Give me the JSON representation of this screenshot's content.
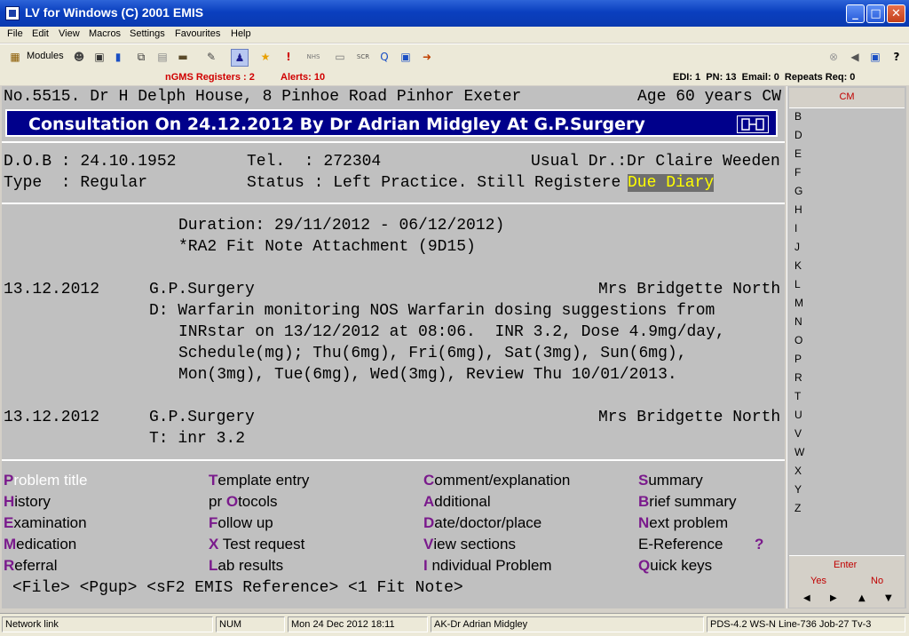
{
  "window": {
    "title": "LV for Windows (C) 2001 EMIS"
  },
  "menu": [
    "File",
    "Edit",
    "View",
    "Macros",
    "Settings",
    "Favourites",
    "Help"
  ],
  "toolbar": {
    "modules_label": "Modules"
  },
  "status_strip": {
    "ngms": "nGMS Registers : 2",
    "alerts": "Alerts: 10",
    "right": "EDI: 1  PN: 13  Email: 0  Repeats Req: 0"
  },
  "patient": {
    "address_line": "No.5515. Dr H Delph House, 8 Pinhoe Road Pinhor Exeter",
    "age": "Age 60 years CW",
    "dob": "D.O.B : 24.10.1952",
    "tel": "Tel.  : 272304",
    "usual_dr": "Usual Dr.:Dr Claire Weeden",
    "type": "Type  : Regular",
    "status": "Status : Left Practice. Still Registere",
    "due_diary": "Due Diary"
  },
  "consultation_banner": "Consultation On 24.12.2012 By Dr Adrian Midgley At G.P.Surgery",
  "entries": {
    "duration": "Duration: 29/11/2012 - 06/12/2012)",
    "fit_note": "*RA2 Fit Note Attachment (9D15)",
    "e1_date": "13.12.2012",
    "e1_place": "G.P.Surgery",
    "e1_author": "Mrs Bridgette North",
    "e1_line1": "D: Warfarin monitoring NOS Warfarin dosing suggestions from",
    "e1_line2": "INRstar on 13/12/2012 at 08:06.  INR 3.2, Dose 4.9mg/day,",
    "e1_line3": "Schedule(mg); Thu(6mg), Fri(6mg), Sat(3mg), Sun(6mg),",
    "e1_line4": "Mon(3mg), Tue(6mg), Wed(3mg), Review Thu 10/01/2013.",
    "e2_date": "13.12.2012",
    "e2_place": "G.P.Surgery",
    "e2_author": "Mrs Bridgette North",
    "e2_line1": "T: inr 3.2"
  },
  "options": [
    {
      "key": "P",
      "rest": "roblem title"
    },
    {
      "key": "T",
      "rest": "emplate entry"
    },
    {
      "key": "C",
      "rest": "omment/explanation"
    },
    {
      "key": "S",
      "rest": "ummary"
    },
    {
      "key": "H",
      "rest": "istory"
    },
    {
      "pre": "pr ",
      "key": "O",
      "rest": "tocols"
    },
    {
      "key": "A",
      "rest": "dditional"
    },
    {
      "key": "B",
      "rest": "rief summary"
    },
    {
      "key": "E",
      "rest": "xamination"
    },
    {
      "key": "F",
      "rest": "ollow up"
    },
    {
      "key": "D",
      "rest": "ate/doctor/place"
    },
    {
      "key": "N",
      "rest": "ext problem"
    },
    {
      "key": "M",
      "rest": "edication"
    },
    {
      "key": "X",
      "rest": " Test request"
    },
    {
      "key": "V",
      "rest": "iew sections"
    },
    {
      "key": "",
      "rest": "E-Reference"
    },
    {
      "key": "R",
      "rest": "eferral"
    },
    {
      "key": "L",
      "rest": "ab results"
    },
    {
      "key": "I",
      "rest": " ndividual Problem"
    },
    {
      "key": "Q",
      "rest": "uick keys"
    }
  ],
  "eref_help": "?",
  "fkeys": "<File> <Pgup> <sF2 EMIS Reference> <1 Fit Note>",
  "right_panel": {
    "cm": "CM",
    "letters": [
      "B",
      "D",
      "E",
      "F",
      "G",
      "H",
      "I",
      "J",
      "K",
      "L",
      "M",
      "N",
      "O",
      "P",
      "R",
      "T",
      "U",
      "V",
      "W",
      "X",
      "Y",
      "Z"
    ],
    "enter": "Enter",
    "yes": "Yes",
    "no": "No"
  },
  "statusbar": {
    "network": "Network link",
    "num": "NUM",
    "datetime": "Mon 24 Dec 2012 18:11",
    "user": "AK-Dr Adrian Midgley",
    "info": "PDS-4.2 WS-N Line-736 Job-27 Tv-3"
  }
}
